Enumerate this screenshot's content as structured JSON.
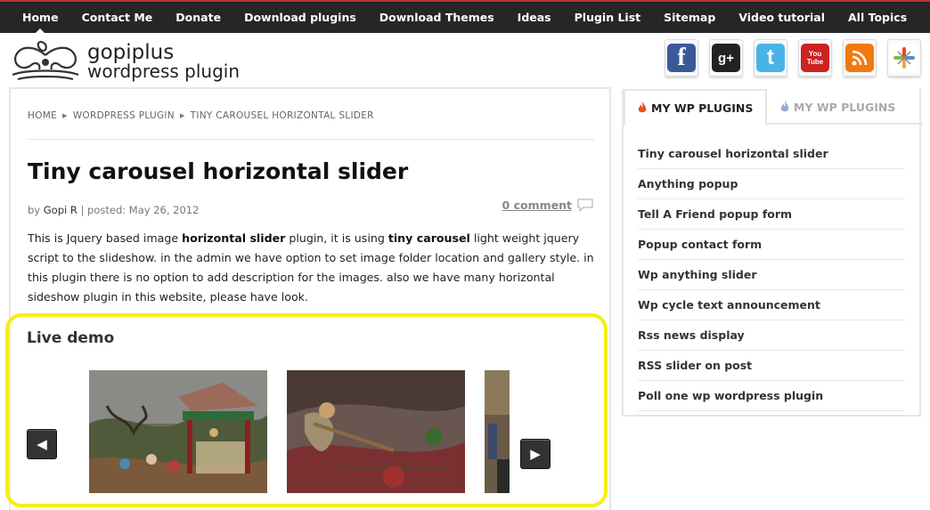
{
  "nav": {
    "items": [
      {
        "label": "Home"
      },
      {
        "label": "Contact Me"
      },
      {
        "label": "Donate"
      },
      {
        "label": "Download plugins"
      },
      {
        "label": "Download Themes"
      },
      {
        "label": "Ideas"
      },
      {
        "label": "Plugin List"
      },
      {
        "label": "Sitemap"
      },
      {
        "label": "Video tutorial"
      },
      {
        "label": "All Topics"
      }
    ]
  },
  "logo": {
    "line1": "gopiplus",
    "line2": "wordpress plugin"
  },
  "social": [
    {
      "icon": "facebook-icon",
      "glyph": "f",
      "color": "#3b5998"
    },
    {
      "icon": "google-plus-icon",
      "glyph": "g+",
      "color": "#222222"
    },
    {
      "icon": "twitter-icon",
      "glyph": "t",
      "color": "#4ab3e6"
    },
    {
      "icon": "youtube-icon",
      "glyph": "You Tube",
      "color": "#cc2222"
    },
    {
      "icon": "rss-icon",
      "glyph": "rss",
      "color": "#f07a10"
    },
    {
      "icon": "joomla-icon",
      "glyph": "J",
      "color": "#ffffff"
    }
  ],
  "breadcrumb": [
    "HOME",
    "WORDPRESS PLUGIN",
    "TINY CAROUSEL HORIZONTAL SLIDER"
  ],
  "post": {
    "title": "Tiny carousel horizontal slider",
    "meta_by": "by",
    "author": "Gopi R",
    "meta_posted": "| posted: May 26, 2012",
    "comments": "0 comment",
    "body": {
      "p1": "This is Jquery based image ",
      "b1": "horizontal slider",
      "p2": " plugin, it is using ",
      "b2": "tiny carousel",
      "p3": " light weight jquery script to the slideshow. in the admin we have option to set image folder location and gallery style. in this plugin there is no option to add description for the images. also we have many horizontal sideshow plugin in this website, please have look."
    }
  },
  "demo": {
    "title": "Live demo",
    "prev": "◀",
    "next": "▶"
  },
  "sidebar": {
    "tabs": [
      {
        "label": "MY WP PLUGINS"
      },
      {
        "label": "MY WP PLUGINS"
      }
    ],
    "plugins": [
      {
        "label": "Tiny carousel horizontal slider"
      },
      {
        "label": "Anything popup"
      },
      {
        "label": "Tell A Friend popup form"
      },
      {
        "label": "Popup contact form"
      },
      {
        "label": "Wp anything slider"
      },
      {
        "label": "Wp cycle text announcement"
      },
      {
        "label": "Rss news display"
      },
      {
        "label": "RSS slider on post"
      },
      {
        "label": "Poll one wp wordpress plugin"
      }
    ]
  },
  "colors": {
    "accent_yellow": "#f5ee12",
    "nav_bg": "#262626",
    "tab_flame_active": "#e8501c",
    "tab_flame_inactive": "#9aa8d8"
  }
}
